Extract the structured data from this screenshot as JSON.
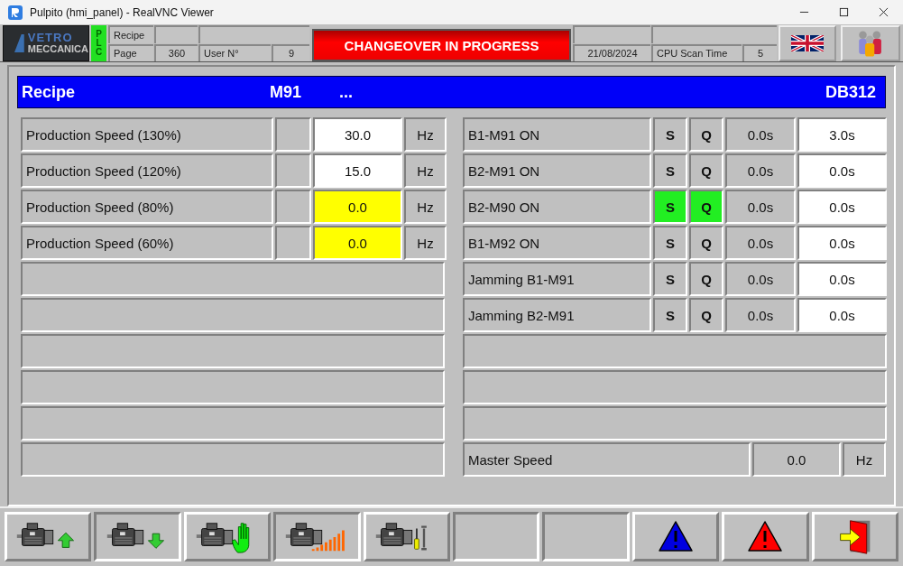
{
  "window": {
    "title": "Pulpito (hmi_panel) - RealVNC Viewer"
  },
  "header": {
    "logo": [
      "VETRO",
      "MECCANICA"
    ],
    "plc": "PLC",
    "recipe_label": "Recipe",
    "page_label": "Page",
    "page": "360",
    "user_label": "User N°",
    "user": "9",
    "banner": "CHANGEOVER IN PROGRESS",
    "date": "21/08/2024",
    "cpu_label": "CPU Scan Time",
    "cpu": "5"
  },
  "recipe_bar": {
    "label": "Recipe",
    "machine": "M91",
    "dots": "...",
    "db": "DB312"
  },
  "speeds": [
    {
      "label": "Production Speed (130%)",
      "value": "30.0",
      "unit": "Hz",
      "alert": false
    },
    {
      "label": "Production Speed (120%)",
      "value": "15.0",
      "unit": "Hz",
      "alert": false
    },
    {
      "label": "Production Speed (80%)",
      "value": "0.0",
      "unit": "Hz",
      "alert": true
    },
    {
      "label": "Production Speed (60%)",
      "value": "0.0",
      "unit": "Hz",
      "alert": true
    }
  ],
  "outputs": [
    {
      "label": "B1-M91 ON",
      "s": "S",
      "s_on": false,
      "q": "Q",
      "q_on": false,
      "time": "0.0s",
      "preset": "3.0s"
    },
    {
      "label": "B2-M91 ON",
      "s": "S",
      "s_on": false,
      "q": "Q",
      "q_on": false,
      "time": "0.0s",
      "preset": "0.0s"
    },
    {
      "label": "B2-M90 ON",
      "s": "S",
      "s_on": true,
      "q": "Q",
      "q_on": true,
      "time": "0.0s",
      "preset": "0.0s"
    },
    {
      "label": "B1-M92 ON",
      "s": "S",
      "s_on": false,
      "q": "Q",
      "q_on": false,
      "time": "0.0s",
      "preset": "0.0s"
    },
    {
      "label": "Jamming B1-M91",
      "s": "S",
      "s_on": false,
      "q": "Q",
      "q_on": false,
      "time": "0.0s",
      "preset": "0.0s"
    },
    {
      "label": "Jamming B2-M91",
      "s": "S",
      "s_on": false,
      "q": "Q",
      "q_on": false,
      "time": "0.0s",
      "preset": "0.0s"
    }
  ],
  "master": {
    "label": "Master Speed",
    "value": "0.0",
    "unit": "Hz"
  },
  "toolbar": [
    {
      "kind": "motor-up",
      "pressed": false
    },
    {
      "kind": "motor-down",
      "pressed": true
    },
    {
      "kind": "motor-hand",
      "pressed": false
    },
    {
      "kind": "motor-ramp",
      "pressed": true
    },
    {
      "kind": "motor-tools",
      "pressed": false
    },
    {
      "kind": "blank",
      "pressed": true
    },
    {
      "kind": "blank",
      "pressed": true
    },
    {
      "kind": "warning-blue",
      "pressed": false
    },
    {
      "kind": "warning-red",
      "pressed": false
    },
    {
      "kind": "exit",
      "pressed": false
    }
  ]
}
